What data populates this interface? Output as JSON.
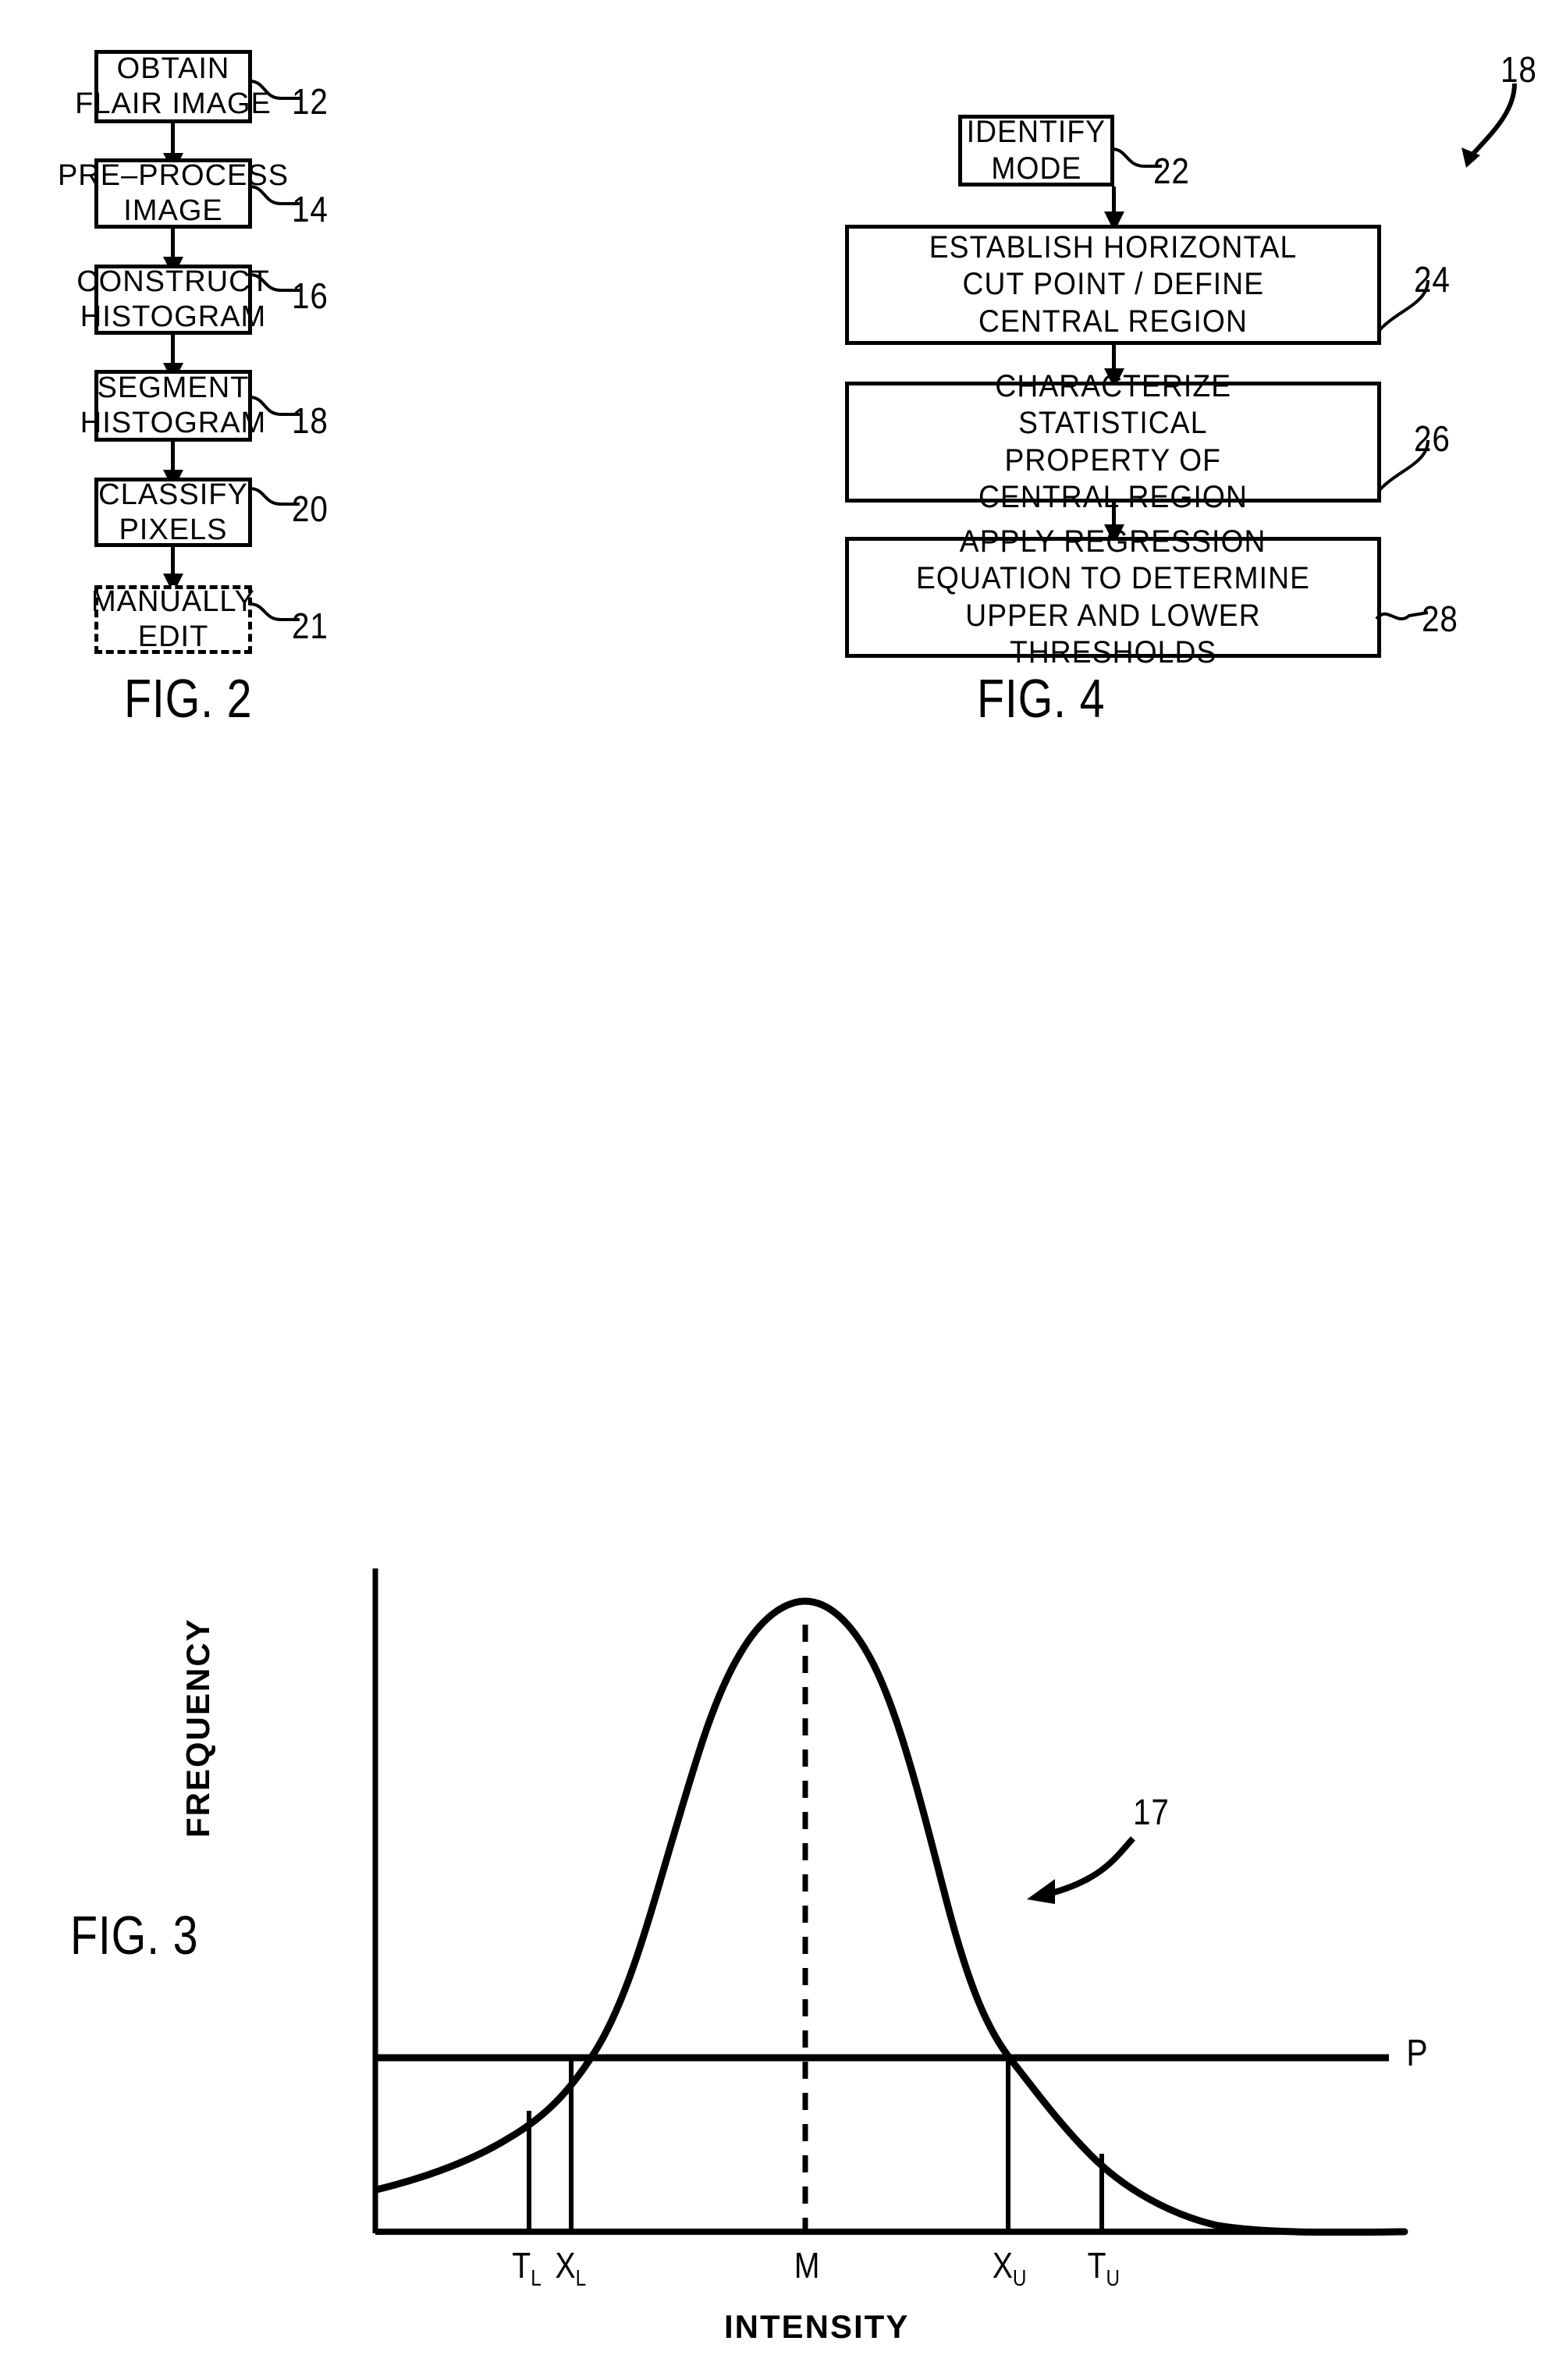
{
  "figures": {
    "fig2": {
      "caption": "FIG. 2",
      "steps": [
        {
          "lines": [
            "OBTAIN",
            "FLAIR  IMAGE"
          ],
          "ref": "12",
          "dashed": false
        },
        {
          "lines": [
            "PRE–PROCESS",
            "IMAGE"
          ],
          "ref": "14",
          "dashed": false
        },
        {
          "lines": [
            "CONSTRUCT",
            "HISTOGRAM"
          ],
          "ref": "16",
          "dashed": false
        },
        {
          "lines": [
            "SEGMENT",
            "HISTOGRAM"
          ],
          "ref": "18",
          "dashed": false
        },
        {
          "lines": [
            "CLASSIFY",
            "PIXELS"
          ],
          "ref": "20",
          "dashed": false
        },
        {
          "lines": [
            "MANUALLY",
            "EDIT"
          ],
          "ref": "21",
          "dashed": true
        }
      ]
    },
    "fig4": {
      "caption": "FIG. 4",
      "diagram_ref": "18",
      "steps": [
        {
          "lines": [
            "IDENTIFY",
            "MODE"
          ],
          "ref": "22"
        },
        {
          "lines": [
            "ESTABLISH  HORIZONTAL",
            "CUT POINT / DEFINE",
            "CENTRAL REGION"
          ],
          "ref": "24"
        },
        {
          "lines": [
            "CHARACTERIZE",
            "STATISTICAL",
            "PROPERTY  OF",
            "CENTRAL REGION"
          ],
          "ref": "26"
        },
        {
          "lines": [
            "APPLY REGRESSION",
            "EQUATION  TO DETERMINE",
            "UPPER AND  LOWER",
            "THRESHOLDS"
          ],
          "ref": "28"
        }
      ]
    },
    "fig3": {
      "caption": "FIG. 3",
      "curve_ref": "17",
      "threshold_line_label": "P"
    }
  },
  "chart_data": {
    "type": "line",
    "title": "FIG. 3",
    "xlabel": "INTENSITY",
    "ylabel": "FREQUENCY",
    "grid": false,
    "legend": false,
    "annotations": [
      {
        "label": "17",
        "target": "histogram-curve",
        "note": "leader arrow pointing to right flank of curve"
      },
      {
        "label": "P",
        "target": "horizontal-cut-point-line",
        "note": "horizontal cut point level drawn across plot"
      }
    ],
    "tick_labels": [
      "T_L",
      "X_L",
      "M",
      "X_U",
      "T_U"
    ],
    "tick_label_display": [
      "TL",
      "XL",
      "M",
      "XU",
      "TU"
    ],
    "tick_x_fractions": [
      0.148,
      0.205,
      0.4,
      0.597,
      0.688
    ],
    "markers": {
      "T_L": {
        "meaning": "lower threshold",
        "x_fraction": 0.148
      },
      "X_L": {
        "meaning": "lower cut point intersection",
        "x_fraction": 0.205
      },
      "M": {
        "meaning": "mode / peak intensity",
        "x_fraction": 0.4
      },
      "X_U": {
        "meaning": "upper cut point intersection",
        "x_fraction": 0.597
      },
      "T_U": {
        "meaning": "upper threshold",
        "x_fraction": 0.688
      }
    },
    "cut_point_level_fraction": 0.245,
    "x": [
      0.0,
      0.05,
      0.1,
      0.148,
      0.205,
      0.25,
      0.3,
      0.35,
      0.4,
      0.45,
      0.5,
      0.55,
      0.597,
      0.64,
      0.688,
      0.74,
      0.8,
      0.88,
      1.0
    ],
    "y": [
      0.055,
      0.075,
      0.105,
      0.135,
      0.245,
      0.43,
      0.72,
      0.93,
      1.0,
      0.95,
      0.76,
      0.47,
      0.245,
      0.15,
      0.095,
      0.055,
      0.03,
      0.012,
      0.005
    ],
    "ylim": [
      0,
      1.05
    ],
    "xlim": [
      0,
      1
    ]
  }
}
